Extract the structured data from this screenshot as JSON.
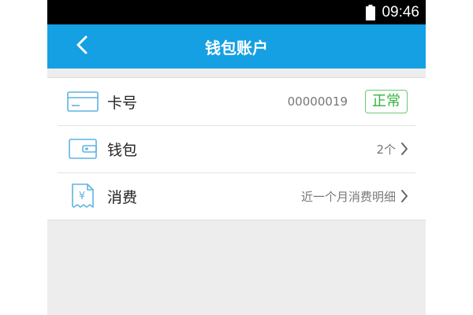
{
  "status_bar": {
    "time": "09:46",
    "battery_icon": "battery-icon"
  },
  "header": {
    "title": "钱包账户",
    "back_icon": "back-arrow-icon",
    "color": "#14a0e3"
  },
  "rows": [
    {
      "label": "卡号",
      "value": "00000019",
      "badge": "正常",
      "icon": "card-icon"
    },
    {
      "label": "钱包",
      "value": "2个",
      "icon": "wallet-icon"
    },
    {
      "label": "消费",
      "value": "近一个月消费明细",
      "icon": "receipt-icon"
    }
  ],
  "colors": {
    "accent": "#14a0e3",
    "badge": "#2fb53a",
    "icon": "#5fb3e0"
  }
}
